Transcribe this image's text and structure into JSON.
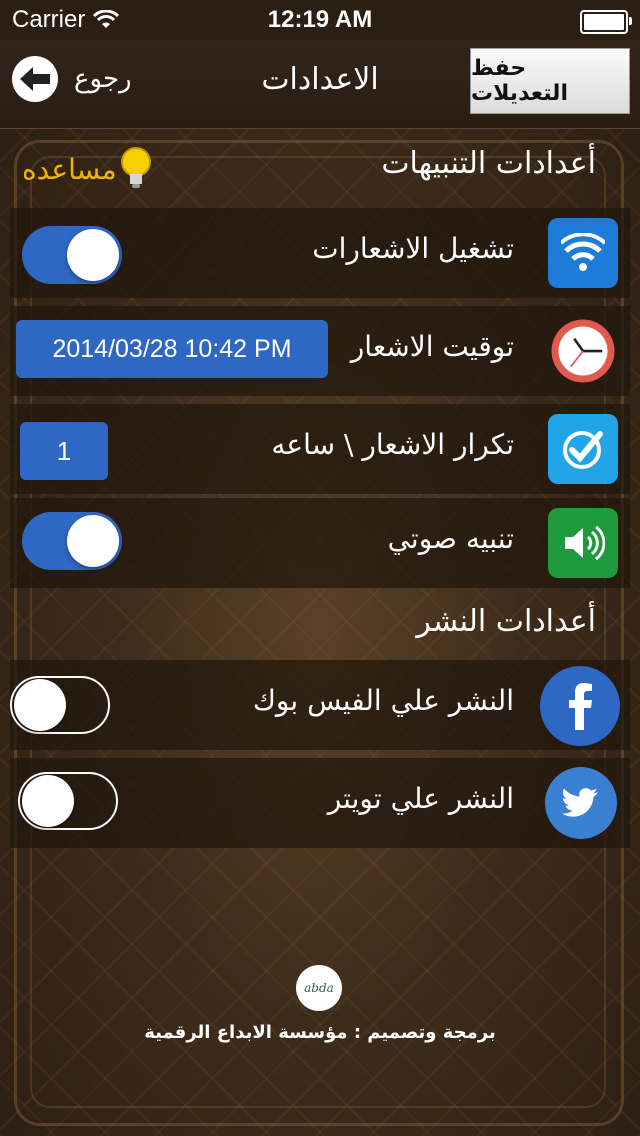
{
  "status": {
    "carrier": "Carrier",
    "time": "12:19 AM"
  },
  "nav": {
    "back_label": "رجوع",
    "title": "الاعدادات",
    "save_label": "حفظ التعديلات"
  },
  "alerts_section": {
    "title": "أعدادات التنبيهات",
    "help_label": "مساعده"
  },
  "rows": [
    {
      "label": "تشغيل الاشعارات",
      "icon": "wifi-icon",
      "control": "toggle",
      "on": true
    },
    {
      "label": "توقيت الاشعار",
      "icon": "clock-icon",
      "control": "date",
      "value": "2014/03/28 10:42 PM"
    },
    {
      "label": "تكرار الاشعار \\ ساعه",
      "icon": "checkmark-icon",
      "control": "number",
      "value": "1"
    },
    {
      "label": "تنبيه صوتي",
      "icon": "speaker-icon",
      "control": "toggle",
      "on": true
    }
  ],
  "publish_section": {
    "title": "أعدادات النشر"
  },
  "publish_rows": [
    {
      "label": "النشر علي الفيس بوك",
      "icon": "facebook-icon",
      "on": false
    },
    {
      "label": "النشر علي تويتر",
      "icon": "twitter-icon",
      "on": false
    }
  ],
  "footer": {
    "logo_text": "abda",
    "credit": "برمجة وتصميم : مؤسسة الابداع الرقمية"
  },
  "colors": {
    "accent": "#2f67c4",
    "help": "#f2b400",
    "background": "#3e2c1b"
  }
}
